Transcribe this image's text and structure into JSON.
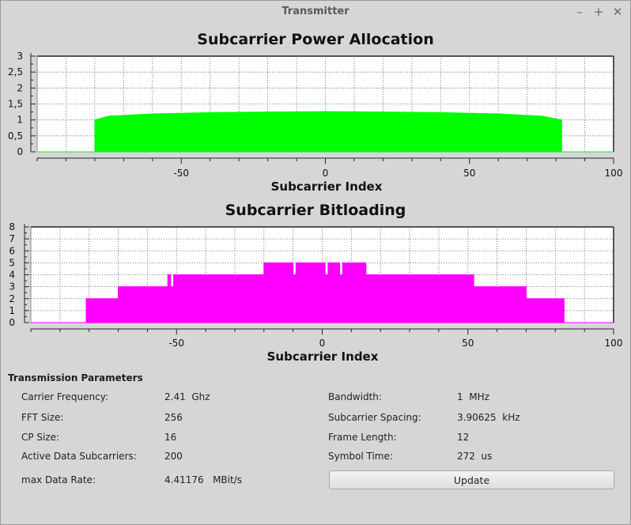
{
  "window": {
    "title": "Transmitter",
    "controls": {
      "minimize": "–",
      "maximize": "+",
      "close": "✕"
    }
  },
  "colors": {
    "background": "#d6d6d6",
    "power_fill": "#00ff00",
    "bitload_fill": "#ff00ff"
  },
  "charts": {
    "power": {
      "title": "Subcarrier Power Allocation",
      "xlabel": "Subcarrier Index"
    },
    "bitload": {
      "title": "Subcarrier Bitloading",
      "xlabel": "Subcarrier Index"
    }
  },
  "chart_data": [
    {
      "type": "area",
      "title": "Subcarrier Power Allocation",
      "xlabel": "Subcarrier Index",
      "ylabel": "",
      "xlim": [
        -100,
        100
      ],
      "ylim": [
        0,
        3
      ],
      "xticks": [
        -50,
        0,
        50,
        100
      ],
      "yticks": [
        0,
        0.5,
        1,
        1.5,
        2,
        2.5,
        3
      ],
      "ytick_labels": [
        "0",
        "0,5",
        "1",
        "1,5",
        "2",
        "2,5",
        "3"
      ],
      "grid": true,
      "x": [
        -100,
        -80,
        -80,
        -75,
        -60,
        -40,
        -20,
        0,
        20,
        40,
        60,
        75,
        82,
        82,
        100
      ],
      "y": [
        0,
        0,
        1.0,
        1.12,
        1.19,
        1.23,
        1.25,
        1.26,
        1.25,
        1.23,
        1.19,
        1.12,
        1.0,
        0,
        0
      ]
    },
    {
      "type": "area",
      "title": "Subcarrier Bitloading",
      "xlabel": "Subcarrier Index",
      "ylabel": "",
      "xlim": [
        -100,
        100
      ],
      "ylim": [
        0,
        8
      ],
      "xticks": [
        -50,
        0,
        50,
        100
      ],
      "yticks": [
        0,
        1,
        2,
        3,
        4,
        5,
        6,
        7,
        8
      ],
      "grid": true,
      "x": [
        -100,
        -81,
        -81,
        -70,
        -70,
        -53,
        -53,
        -52,
        -52,
        -51,
        -51,
        -20,
        -20,
        -10,
        -10,
        -9,
        -9,
        1,
        1,
        2,
        2,
        6,
        6,
        7,
        7,
        15,
        15,
        52,
        52,
        70,
        70,
        83,
        83,
        100
      ],
      "y": [
        0,
        0,
        2,
        2,
        3,
        3,
        4,
        4,
        3,
        3,
        4,
        4,
        5,
        5,
        4,
        4,
        5,
        5,
        4,
        4,
        5,
        5,
        4,
        4,
        5,
        5,
        4,
        4,
        3,
        3,
        2,
        2,
        0,
        0
      ]
    }
  ],
  "params": {
    "section_title": "Transmission Parameters",
    "left": [
      {
        "label": "Carrier Frequency:",
        "value": "2.41  Ghz"
      },
      {
        "label": "FFT Size:",
        "value": "256"
      },
      {
        "label": "CP Size:",
        "value": "16"
      },
      {
        "label": "Active Data Subcarriers:",
        "value": "200"
      },
      {
        "label": "max Data Rate:",
        "value": "4.41176   MBit/s"
      }
    ],
    "right": [
      {
        "label": "Bandwidth:",
        "value": "1  MHz"
      },
      {
        "label": "Subcarrier Spacing:",
        "value": "3.90625  kHz"
      },
      {
        "label": "Frame Length:",
        "value": "12"
      },
      {
        "label": "Symbol Time:",
        "value": "272  us"
      }
    ],
    "update_label": "Update"
  }
}
